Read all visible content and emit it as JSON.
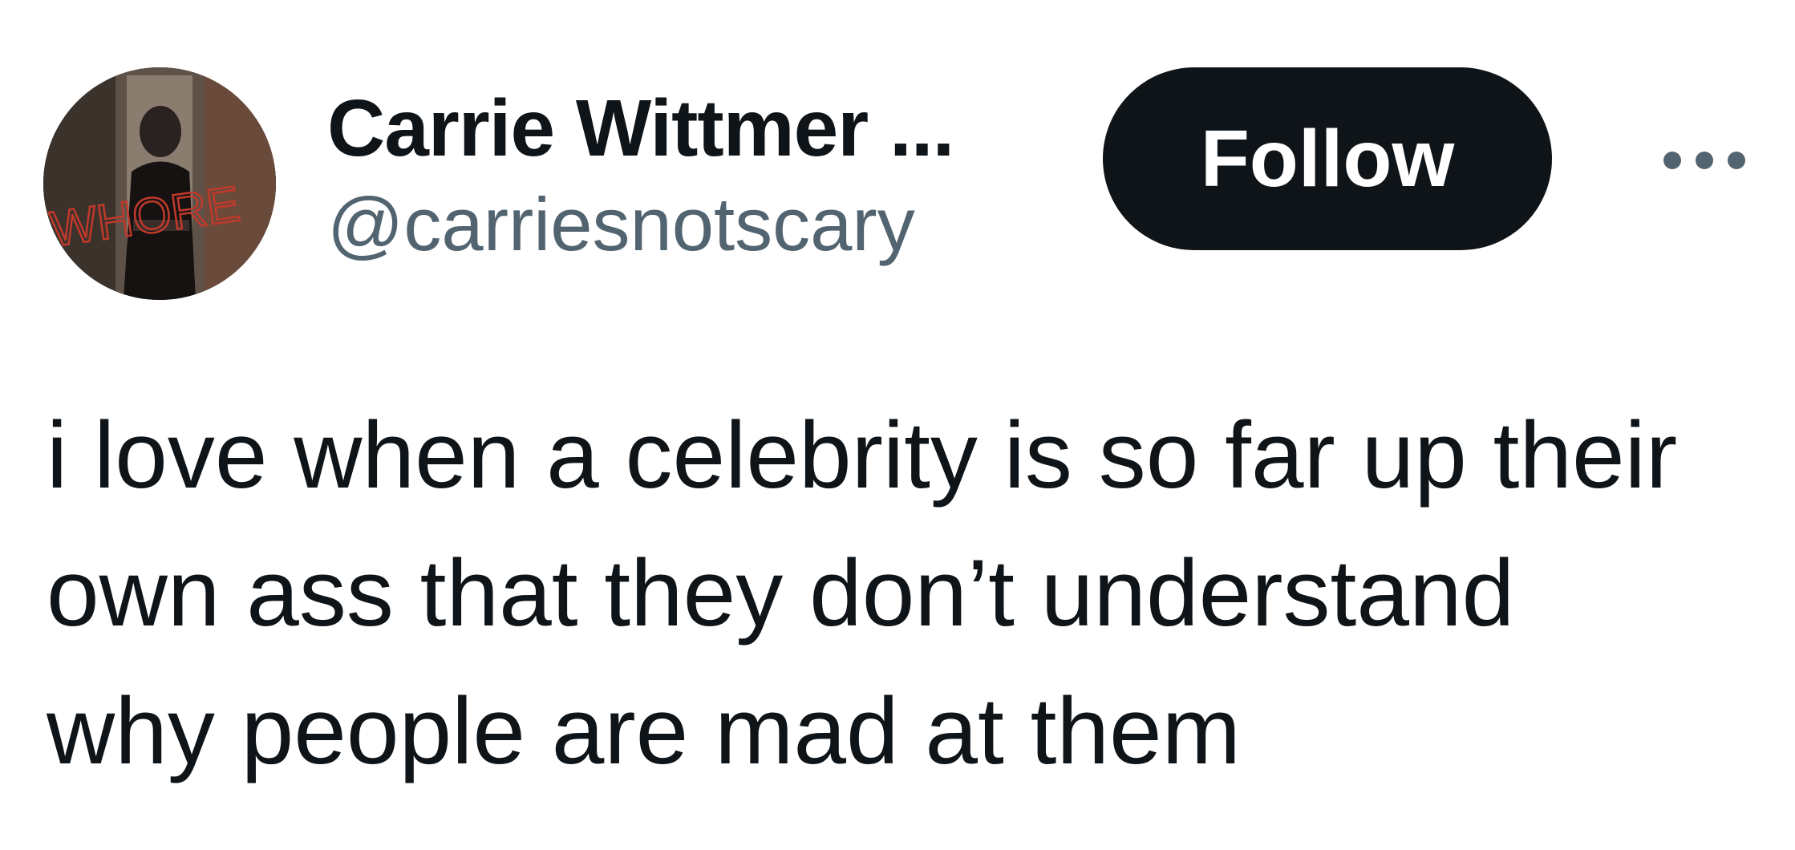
{
  "tweet": {
    "author": {
      "display_name": "Carrie Wittmer ...",
      "handle": "@carriesnotscary",
      "avatar_overlay_text": "WHORE"
    },
    "follow_label": "Follow",
    "more_icon": "more-horizontal-icon",
    "text_lines": [
      "i love when a celebrity is so far up their",
      "own ass that they don’t understand",
      "why people are mad at them"
    ]
  },
  "colors": {
    "text_primary": "#0f1419",
    "text_secondary": "#536471",
    "button_bg": "#0f1419",
    "button_text": "#ffffff",
    "avatar_scrawl": "#c0392b"
  }
}
